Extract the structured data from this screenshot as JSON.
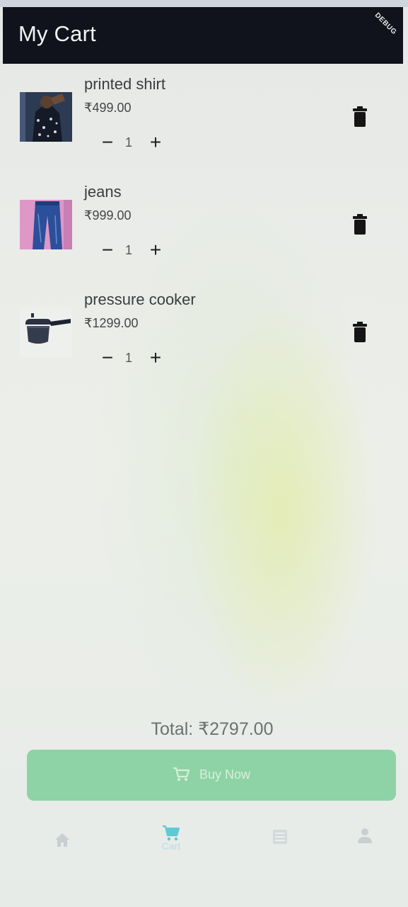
{
  "app_bar": {
    "title": "My Cart",
    "debug_banner": "DEBUG"
  },
  "cart": {
    "items": [
      {
        "name": "printed shirt",
        "price": "₹499.00",
        "quantity": "1",
        "decrement": "−",
        "increment": "+"
      },
      {
        "name": "jeans",
        "price": "₹999.00",
        "quantity": "1",
        "decrement": "−",
        "increment": "+"
      },
      {
        "name": "pressure cooker",
        "price": "₹1299.00",
        "quantity": "1",
        "decrement": "−",
        "increment": "+"
      }
    ]
  },
  "summary": {
    "total": "Total: ₹2797.00",
    "buy_label": "Buy Now"
  },
  "bottom_nav": {
    "items": [
      {
        "icon": "home-icon",
        "label": ""
      },
      {
        "icon": "cart-icon",
        "label": "Cart"
      },
      {
        "icon": "orders-icon",
        "label": ""
      },
      {
        "icon": "profile-icon",
        "label": ""
      }
    ],
    "active_color": "#5fc9d6",
    "inactive_color": "#c9cfd1"
  },
  "colors": {
    "app_bar": "#10131c",
    "buy_button": "#8ed3a5"
  }
}
